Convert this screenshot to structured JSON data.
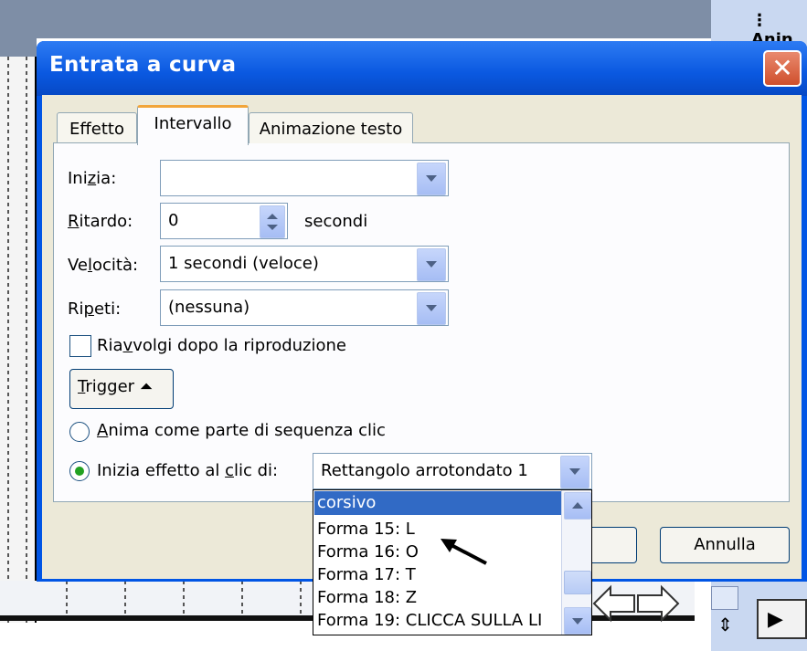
{
  "background": {
    "right_pane_label": "Anin"
  },
  "dialog": {
    "title": "Entrata a curva",
    "close_symbol": "✕",
    "tabs": [
      {
        "label": "Effetto",
        "active": false
      },
      {
        "label": "Intervallo",
        "active": true
      },
      {
        "label": "Animazione testo",
        "active": false
      }
    ],
    "inizia": {
      "label_pre": "Ini",
      "label_u": "z",
      "label_post": "ia:",
      "value": ""
    },
    "ritardo": {
      "label_pre": "",
      "label_u": "R",
      "label_post": "itardo:",
      "value": "0",
      "unit": "secondi"
    },
    "velocita": {
      "label_pre": "Ve",
      "label_u": "l",
      "label_post": "ocità:",
      "value": "1 secondi (veloce)"
    },
    "ripeti": {
      "label_pre": "Ri",
      "label_u": "p",
      "label_post": "eti:",
      "value": "(nessuna)"
    },
    "riavvolgi": {
      "label_pre": "Ria",
      "label_u": "v",
      "label_post": "volgi dopo la riproduzione",
      "checked": false
    },
    "trigger": {
      "label_pre": "",
      "label_u": "T",
      "label_post": "rigger",
      "glyph": "⏶"
    },
    "radio_sequenza": {
      "label_pre": "",
      "label_u": "A",
      "label_post": "nima come parte di sequenza clic",
      "selected": false
    },
    "radio_clic": {
      "label_pre": "Inizia effetto al ",
      "label_u": "c",
      "label_post": "lic di:",
      "selected": true,
      "value": "Rettangolo arrotondato 1"
    },
    "dropdown_items": [
      "corsivo",
      "Forma 15: L",
      "Forma 16: O",
      "Forma 17: T",
      "Forma 18: Z",
      "Forma 19: CLICCA SULLA LI"
    ],
    "annulla_label": "Annulla"
  },
  "colors": {
    "title_bar": "#0a58e0",
    "selection": "#316ac5",
    "tab_accent": "#f2a53a",
    "dialog_face": "#ece9d8"
  }
}
